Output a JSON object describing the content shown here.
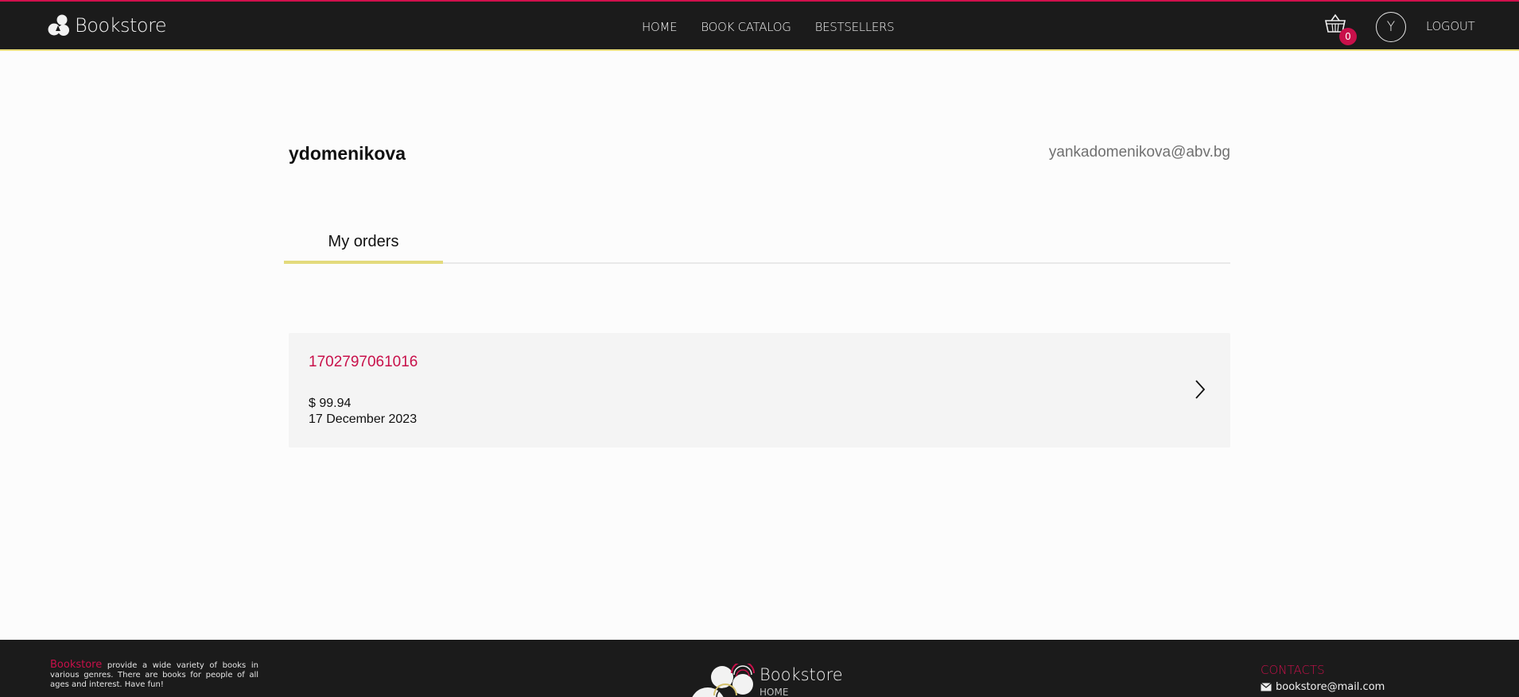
{
  "header": {
    "brand": "Bookstore",
    "nav": [
      "HOME",
      "BOOK CATALOG",
      "BESTSELLERS"
    ],
    "cart_count": "0",
    "avatar_initial": "Y",
    "logout": "LOGOUT"
  },
  "profile": {
    "username": "ydomenikova",
    "email": "yankadomenikova@abv.bg"
  },
  "tabs": {
    "active": "My orders"
  },
  "orders": [
    {
      "id": "1702797061016",
      "total": "$ 99.94",
      "date": "17 December 2023"
    }
  ],
  "footer": {
    "about_brand": "Bookstore",
    "about_text": " provide a wide variety of books in various genres. There are books for people of all ages and interest. Have fun!",
    "brand": "Bookstore",
    "home_link": "HOME",
    "contacts_title": "CONTACTS",
    "email": "bookstore@mail.com"
  },
  "colors": {
    "accent": "#c8104a",
    "highlight": "#e3da7c",
    "header_bg": "#1b1b1b"
  }
}
